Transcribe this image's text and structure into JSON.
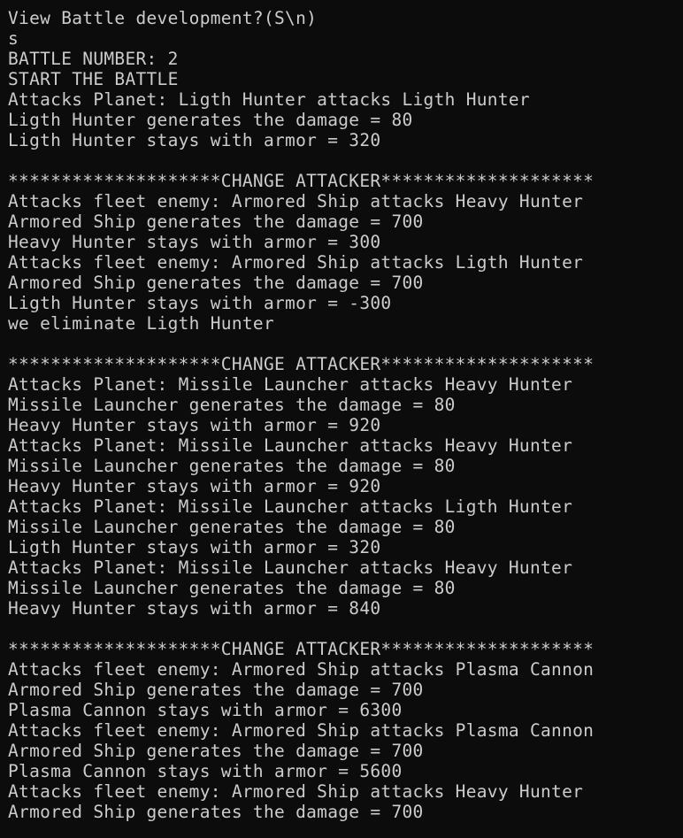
{
  "console": {
    "lines": [
      "View Battle development?(S\\n)",
      "s",
      "BATTLE NUMBER: 2",
      "START THE BATTLE",
      "Attacks Planet: Ligth Hunter attacks Ligth Hunter",
      "Ligth Hunter generates the damage = 80",
      "Ligth Hunter stays with armor = 320",
      "",
      "********************CHANGE ATTACKER********************",
      "Attacks fleet enemy: Armored Ship attacks Heavy Hunter",
      "Armored Ship generates the damage = 700",
      "Heavy Hunter stays with armor = 300",
      "Attacks fleet enemy: Armored Ship attacks Ligth Hunter",
      "Armored Ship generates the damage = 700",
      "Ligth Hunter stays with armor = -300",
      "we eliminate Ligth Hunter",
      "",
      "********************CHANGE ATTACKER********************",
      "Attacks Planet: Missile Launcher attacks Heavy Hunter",
      "Missile Launcher generates the damage = 80",
      "Heavy Hunter stays with armor = 920",
      "Attacks Planet: Missile Launcher attacks Heavy Hunter",
      "Missile Launcher generates the damage = 80",
      "Heavy Hunter stays with armor = 920",
      "Attacks Planet: Missile Launcher attacks Ligth Hunter",
      "Missile Launcher generates the damage = 80",
      "Ligth Hunter stays with armor = 320",
      "Attacks Planet: Missile Launcher attacks Heavy Hunter",
      "Missile Launcher generates the damage = 80",
      "Heavy Hunter stays with armor = 840",
      "",
      "********************CHANGE ATTACKER********************",
      "Attacks fleet enemy: Armored Ship attacks Plasma Cannon",
      "Armored Ship generates the damage = 700",
      "Plasma Cannon stays with armor = 6300",
      "Attacks fleet enemy: Armored Ship attacks Plasma Cannon",
      "Armored Ship generates the damage = 700",
      "Plasma Cannon stays with armor = 5600",
      "Attacks fleet enemy: Armored Ship attacks Heavy Hunter",
      "Armored Ship generates the damage = 700"
    ]
  },
  "colors": {
    "background": "#0c0c0c",
    "text": "#cccccc"
  }
}
